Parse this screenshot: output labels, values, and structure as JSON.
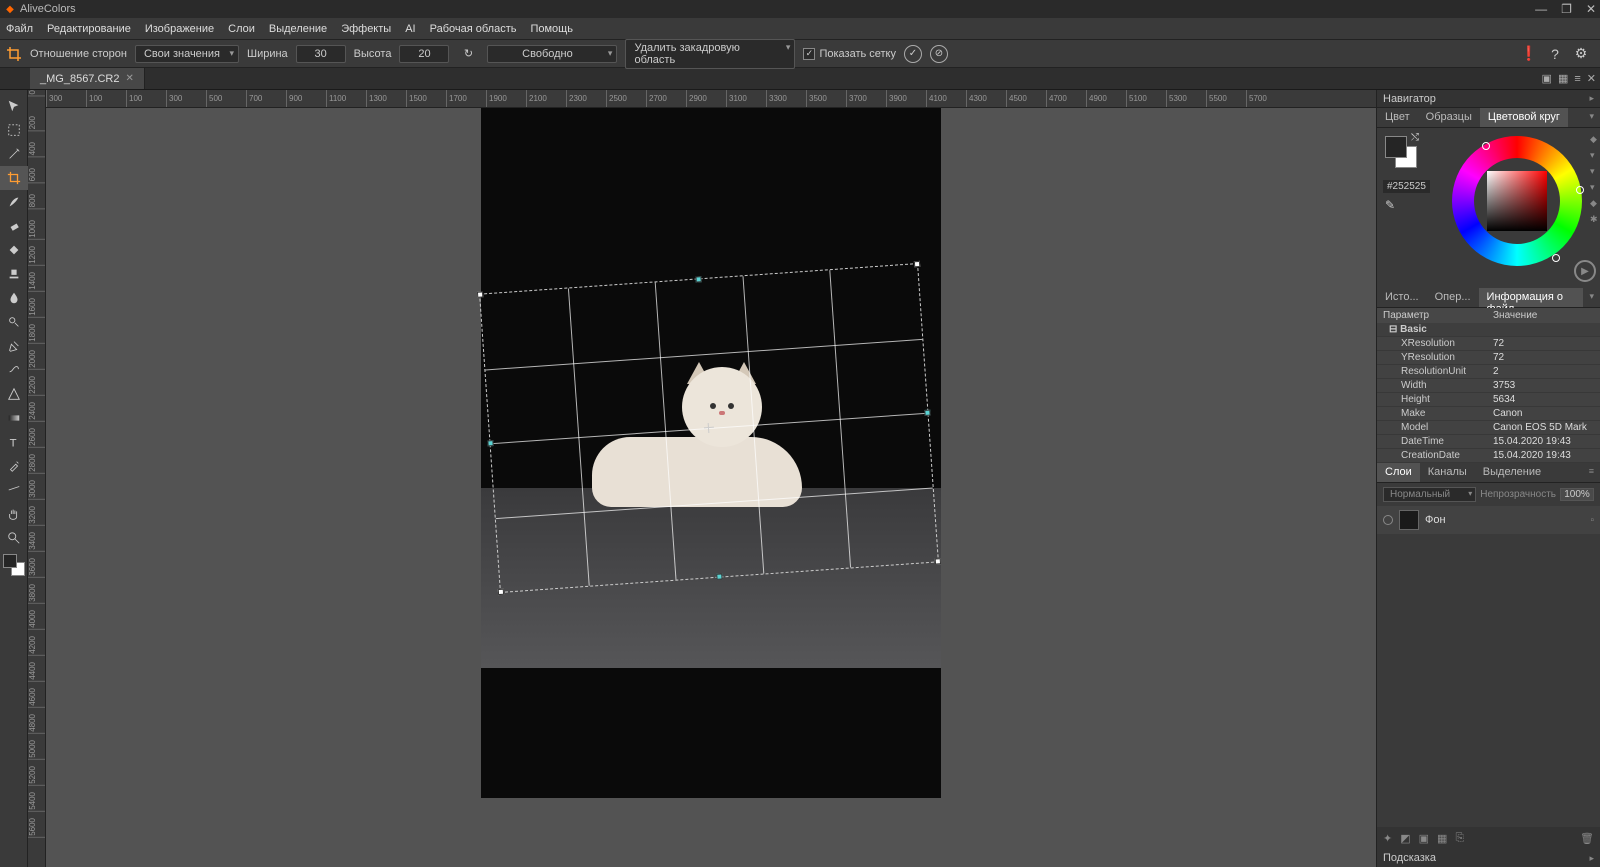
{
  "app": {
    "title": "AliveColors"
  },
  "menu": [
    "Файл",
    "Редактирование",
    "Изображение",
    "Слои",
    "Выделение",
    "Эффекты",
    "AI",
    "Рабочая область",
    "Помощь"
  ],
  "options": {
    "ratio_label": "Отношение сторон",
    "ratio_value": "Свои значения",
    "width_label": "Ширина",
    "width_value": "30",
    "height_label": "Высота",
    "height_value": "20",
    "mode_value": "Свободно",
    "delete_value": "Удалить закадровую область",
    "show_grid_label": "Показать сетку",
    "show_grid_checked": true
  },
  "tab": {
    "filename": "_MG_8567.CR2"
  },
  "ruler_ticks": [
    "300",
    "100",
    "100",
    "300",
    "500",
    "700",
    "900",
    "1100",
    "1300",
    "1500",
    "1700",
    "1900",
    "2100",
    "2300",
    "2500",
    "2700",
    "2900",
    "3100",
    "3300",
    "3500",
    "3700",
    "3900",
    "4100",
    "4300",
    "4500",
    "4700",
    "4900",
    "5100",
    "5300",
    "5500",
    "5700"
  ],
  "vruler_ticks": [
    "0",
    "200",
    "400",
    "600",
    "800",
    "1000",
    "1200",
    "1400",
    "1600",
    "1800",
    "2000",
    "2200",
    "2400",
    "2600",
    "2800",
    "3000",
    "3200",
    "3400",
    "3600",
    "3800",
    "4000",
    "4200",
    "4400",
    "4600",
    "4800",
    "5000",
    "5200",
    "5400",
    "5600"
  ],
  "navigator": {
    "title": "Навигатор"
  },
  "color_tabs": [
    "Цвет",
    "Образцы",
    "Цветовой круг"
  ],
  "color": {
    "hex": "#252525"
  },
  "info_tabs": [
    "Исто...",
    "Опер...",
    "Информация о файл"
  ],
  "info": {
    "header_param": "Параметр",
    "header_value": "Значение",
    "group": "Basic",
    "rows": [
      {
        "k": "XResolution",
        "v": "72"
      },
      {
        "k": "YResolution",
        "v": "72"
      },
      {
        "k": "ResolutionUnit",
        "v": "2"
      },
      {
        "k": "Width",
        "v": "3753"
      },
      {
        "k": "Height",
        "v": "5634"
      },
      {
        "k": "Make",
        "v": "Canon"
      },
      {
        "k": "Model",
        "v": "Canon EOS 5D Mark"
      },
      {
        "k": "DateTime",
        "v": "15.04.2020 19:43"
      },
      {
        "k": "CreationDate",
        "v": "15.04.2020 19:43"
      }
    ]
  },
  "layer_tabs": [
    "Слои",
    "Каналы",
    "Выделение"
  ],
  "layers": {
    "blend_label": "Нормальный",
    "opacity_label": "Непрозрачность",
    "opacity_value": "100%",
    "items": [
      {
        "name": "Фон"
      }
    ]
  },
  "hint": {
    "label": "Подсказка"
  }
}
